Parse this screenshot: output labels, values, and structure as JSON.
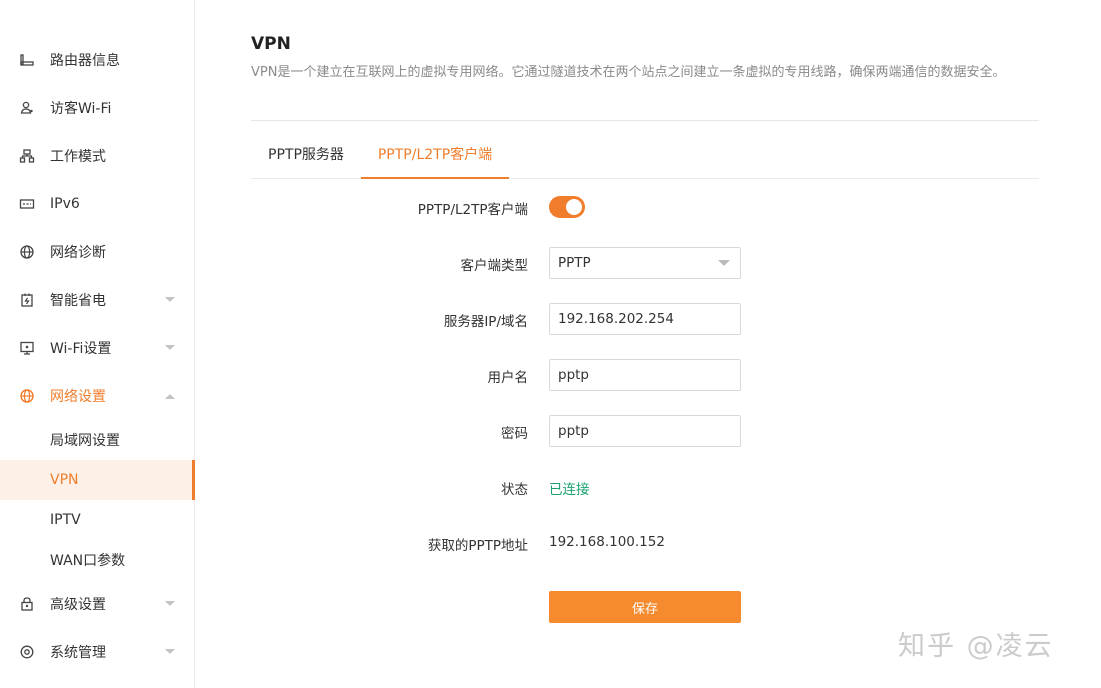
{
  "sidebar": {
    "items": [
      {
        "label": "路由器信息",
        "icon": "router-info-icon"
      },
      {
        "label": "访客Wi-Fi",
        "icon": "guest-user-icon"
      },
      {
        "label": "工作模式",
        "icon": "work-mode-icon"
      },
      {
        "label": "IPv6",
        "icon": "ipv6-icon"
      },
      {
        "label": "网络诊断",
        "icon": "globe-icon"
      },
      {
        "label": "智能省电",
        "icon": "power-saving-icon"
      },
      {
        "label": "Wi-Fi设置",
        "icon": "wifi-settings-icon"
      },
      {
        "label": "网络设置",
        "icon": "network-globe-icon"
      },
      {
        "label": "高级设置",
        "icon": "advanced-settings-icon"
      },
      {
        "label": "系统管理",
        "icon": "system-management-icon"
      }
    ],
    "network_sub": [
      "局域网设置",
      "VPN",
      "IPTV",
      "WAN口参数"
    ],
    "active_sub": "VPN"
  },
  "main": {
    "title": "VPN",
    "description": "VPN是一个建立在互联网上的虚拟专用网络。它通过隧道技术在两个站点之间建立一条虚拟的专用线路，确保两端通信的数据安全。",
    "tabs": [
      {
        "label": "PPTP服务器"
      },
      {
        "label": "PPTP/L2TP客户端"
      }
    ],
    "form": {
      "client_toggle_label": "PPTP/L2TP客户端",
      "client_toggle_on": true,
      "client_type_label": "客户端类型",
      "client_type_value": "PPTP",
      "server_label": "服务器IP/域名",
      "server_value": "192.168.202.254",
      "username_label": "用户名",
      "username_value": "pptp",
      "password_label": "密码",
      "password_value": "pptp",
      "status_label": "状态",
      "status_value": "已连接",
      "address_label": "获取的PPTP地址",
      "address_value": "192.168.100.152",
      "save_label": "保存"
    }
  },
  "colors": {
    "accent": "#f07d2c",
    "button": "#f58a2e",
    "status_ok": "#1aa36e"
  },
  "watermark": "知乎 @凌云"
}
